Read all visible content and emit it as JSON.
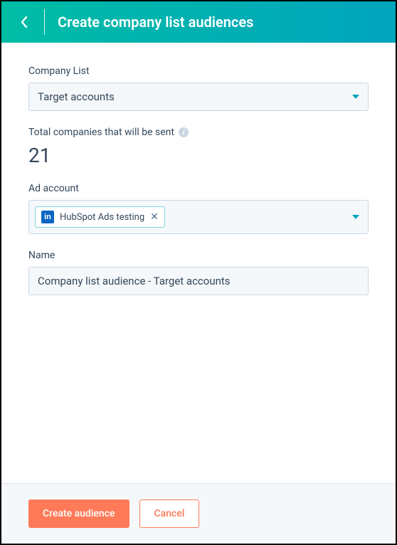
{
  "header": {
    "title": "Create company list audiences"
  },
  "fields": {
    "company_list": {
      "label": "Company List",
      "value": "Target accounts"
    },
    "total_companies": {
      "label": "Total companies that will be sent",
      "value": "21"
    },
    "ad_account": {
      "label": "Ad account",
      "selected": {
        "provider": "linkedin",
        "provider_badge_text": "in",
        "name": "HubSpot Ads testing"
      }
    },
    "name": {
      "label": "Name",
      "value": "Company list audience - Target accounts"
    }
  },
  "footer": {
    "primary": "Create audience",
    "secondary": "Cancel"
  }
}
